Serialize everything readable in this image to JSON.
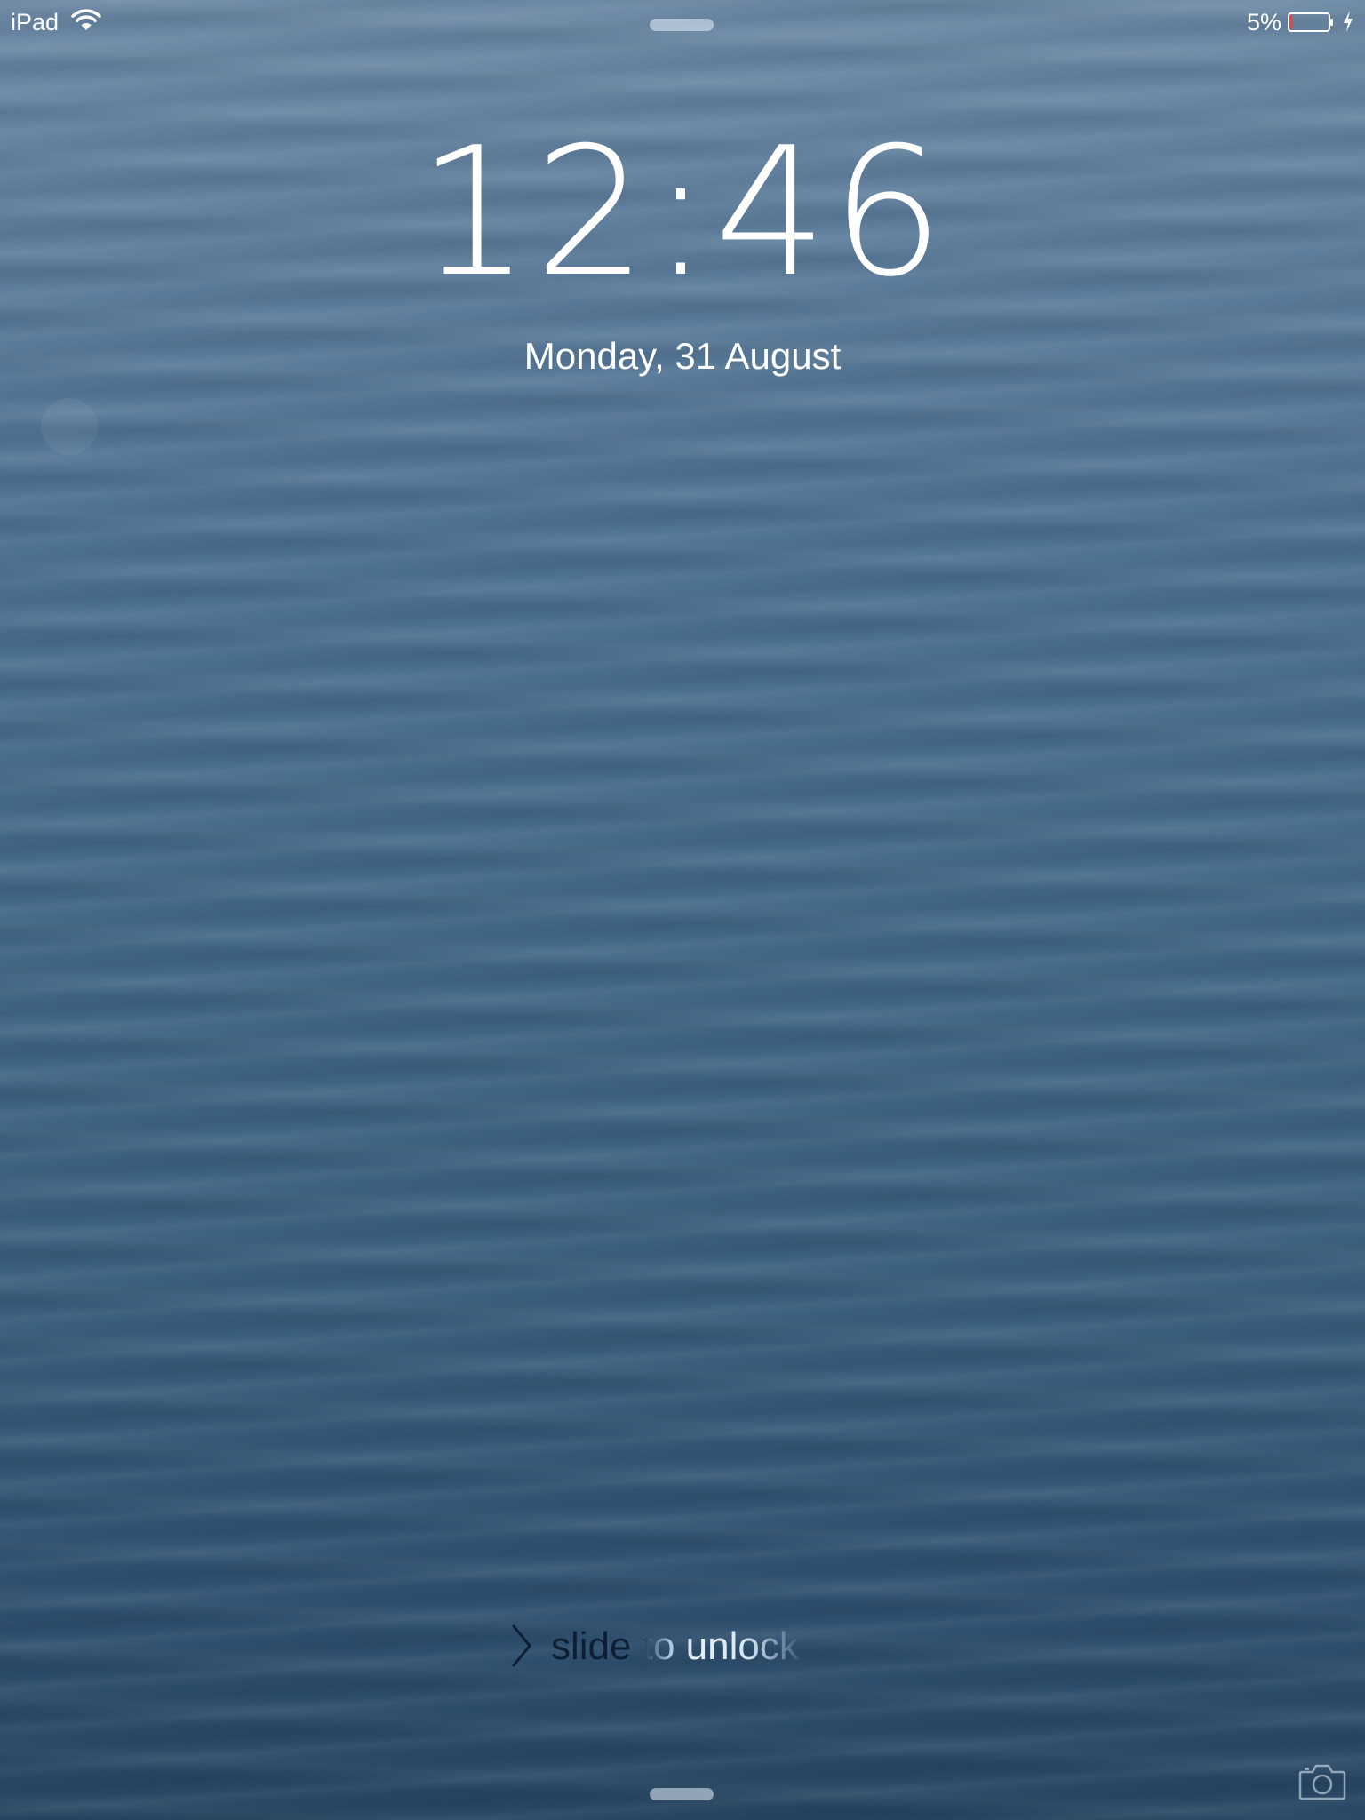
{
  "status_bar": {
    "carrier": "iPad",
    "wifi_icon": "wifi-icon",
    "battery_percent": "5%",
    "battery_level": 0.05,
    "battery_icon": "battery-icon",
    "charging_icon": "charging-bolt-icon"
  },
  "lock_screen": {
    "time": "12:46",
    "date": "Monday, 31 August",
    "slider_label": "slide to unlock",
    "slider_icon": "chevron-right-icon",
    "camera_icon": "camera-icon",
    "top_grabber": "notification-center-grabber",
    "bottom_grabber": "control-center-grabber"
  },
  "colors": {
    "text": "#ffffff",
    "battery_low": "#ff3b30",
    "wallpaper_top": "#6e8aa6",
    "wallpaper_bottom": "#274662"
  }
}
